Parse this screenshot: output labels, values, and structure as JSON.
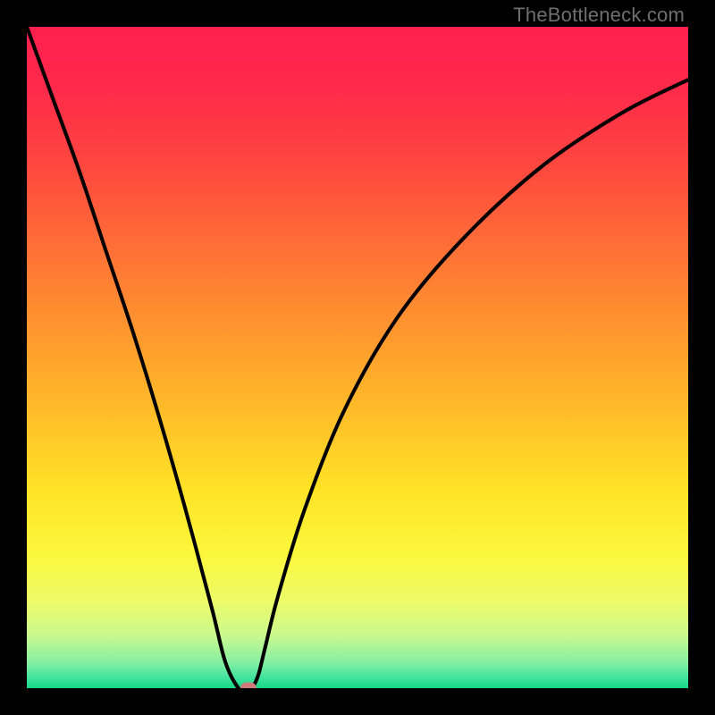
{
  "watermark": "TheBottleneck.com",
  "chart_data": {
    "type": "line",
    "title": "",
    "xlabel": "",
    "ylabel": "",
    "xlim": [
      0,
      100
    ],
    "ylim": [
      0,
      100
    ],
    "curve": {
      "x": [
        0,
        4,
        8,
        12,
        16,
        20,
        24,
        28,
        30,
        32,
        33,
        34,
        35,
        36,
        38,
        42,
        48,
        56,
        66,
        78,
        90,
        100
      ],
      "y": [
        100,
        89,
        78,
        66,
        54,
        41,
        27,
        12,
        4,
        0,
        0,
        0,
        2,
        6,
        14,
        27,
        42,
        56,
        68,
        79,
        87,
        92
      ]
    },
    "marker": {
      "x": 33.5,
      "y": 0
    },
    "gradient_stops": [
      {
        "pos": 0.0,
        "color": "#ff1f4f"
      },
      {
        "pos": 0.1,
        "color": "#ff2b4a"
      },
      {
        "pos": 0.22,
        "color": "#ff4a3e"
      },
      {
        "pos": 0.38,
        "color": "#ff7e33"
      },
      {
        "pos": 0.55,
        "color": "#ffb22a"
      },
      {
        "pos": 0.7,
        "color": "#ffe326"
      },
      {
        "pos": 0.8,
        "color": "#fbf83d"
      },
      {
        "pos": 0.87,
        "color": "#edfb6a"
      },
      {
        "pos": 0.92,
        "color": "#c9f98e"
      },
      {
        "pos": 0.96,
        "color": "#89efa2"
      },
      {
        "pos": 0.985,
        "color": "#3fe39e"
      },
      {
        "pos": 1.0,
        "color": "#14d884"
      }
    ]
  }
}
